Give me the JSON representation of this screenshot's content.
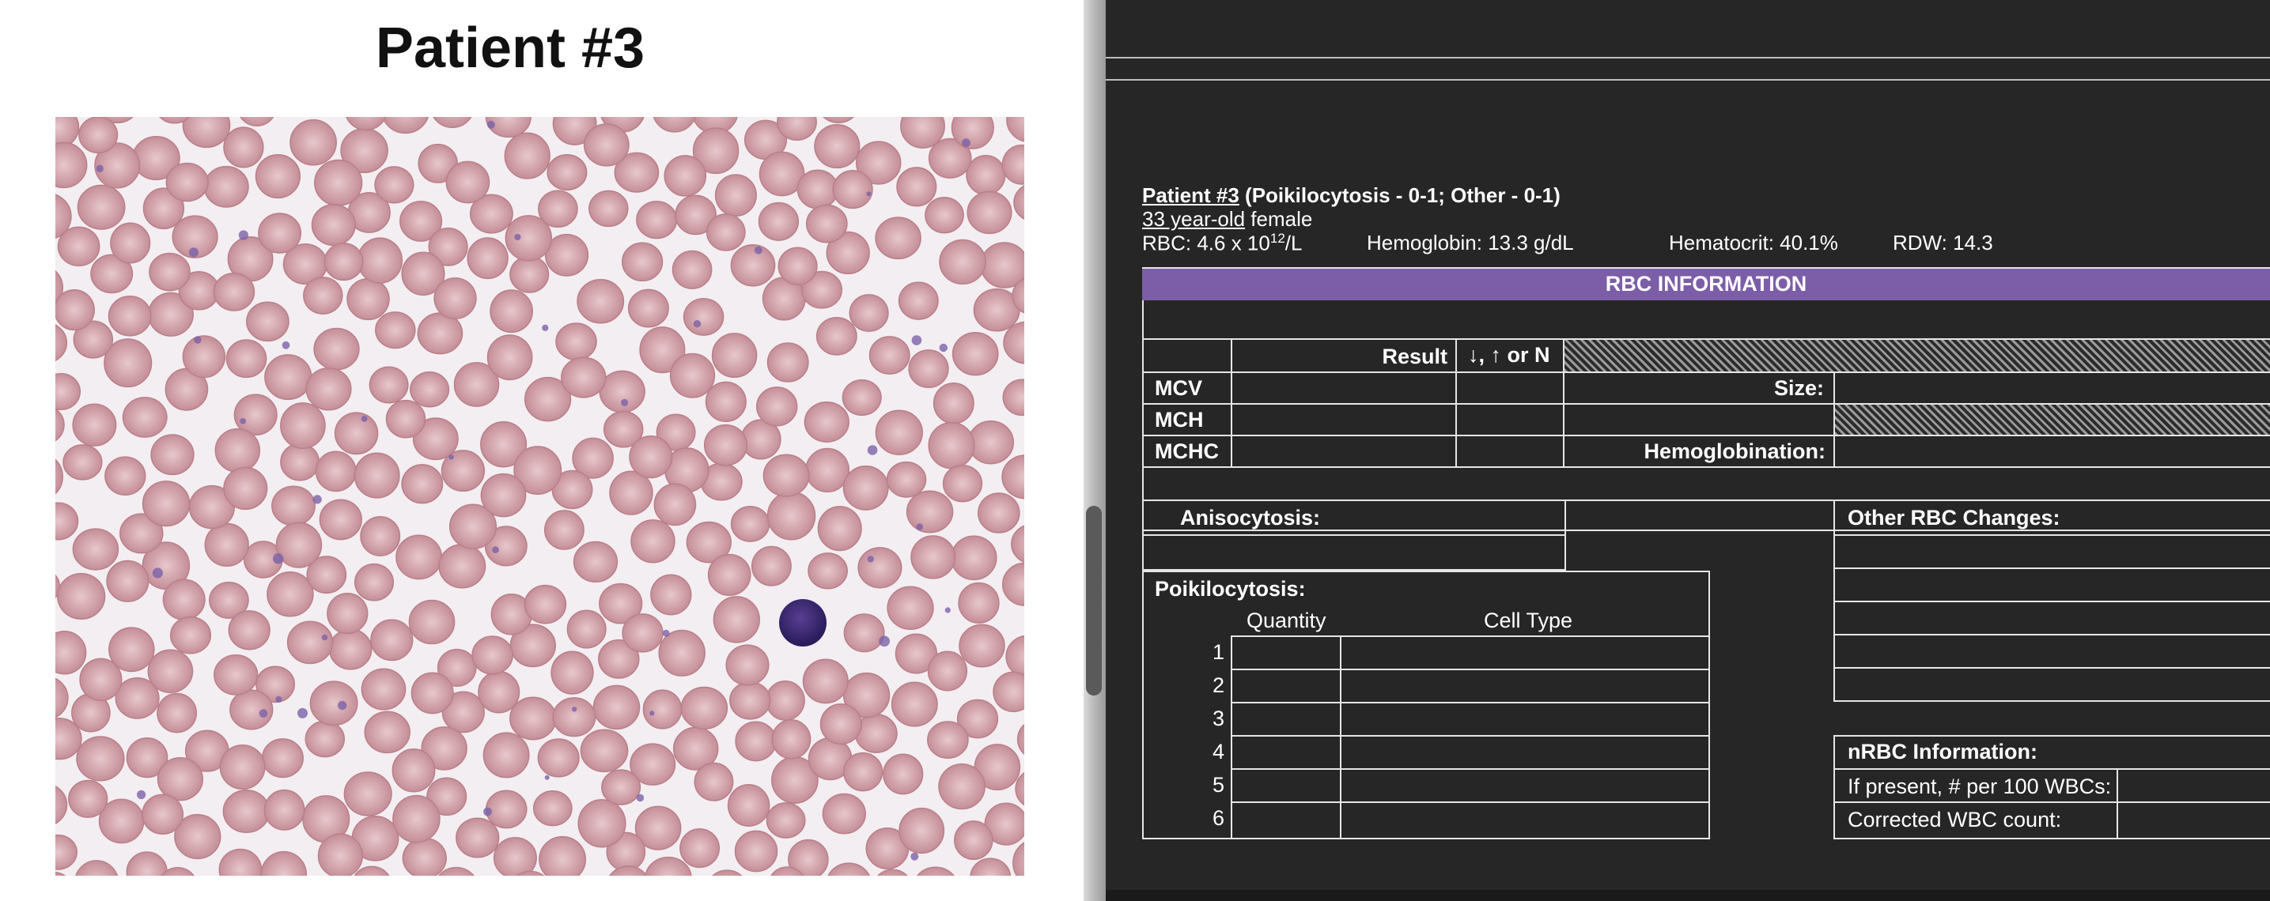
{
  "left": {
    "title": "Patient #3"
  },
  "case": {
    "patient_link": "Patient #3",
    "header_rest": " (Poikilocytosis - 0-1; Other - 0-1)",
    "age_link": "33 year-old",
    "sex": " female",
    "rbc_label": "RBC:  4.6 x 10",
    "rbc_sup": "12",
    "rbc_unit": "/L",
    "hemoglobin": "Hemoglobin:  13.3 g/dL",
    "hematocrit": "Hematocrit:  40.1%",
    "rdw": "RDW:  14.3"
  },
  "rbc_table": {
    "banner": "RBC INFORMATION",
    "col_result": "Result",
    "col_direction": "↓, ↑ or N",
    "rows": [
      "MCV",
      "MCH",
      "MCHC"
    ],
    "size_label": "Size:",
    "hemoglobination_label": "Hemoglobination:"
  },
  "anisocytosis_label": "Anisocytosis:",
  "other_rbc_label": "Other RBC Changes:",
  "poik": {
    "label": "Poikilocytosis:",
    "col_quantity": "Quantity",
    "col_celltype": "Cell Type",
    "numbers": [
      "1",
      "2",
      "3",
      "4",
      "5",
      "6"
    ]
  },
  "nrbc": {
    "label": "nRBC Information:",
    "per100": "If present, # per 100 WBCs:",
    "corrected": "Corrected WBC count:"
  },
  "colors": {
    "panel_bg": "#262626",
    "banner": "#7b5ea7",
    "rbc": "#d3a3ab",
    "wbc": "#3f2d7a"
  }
}
